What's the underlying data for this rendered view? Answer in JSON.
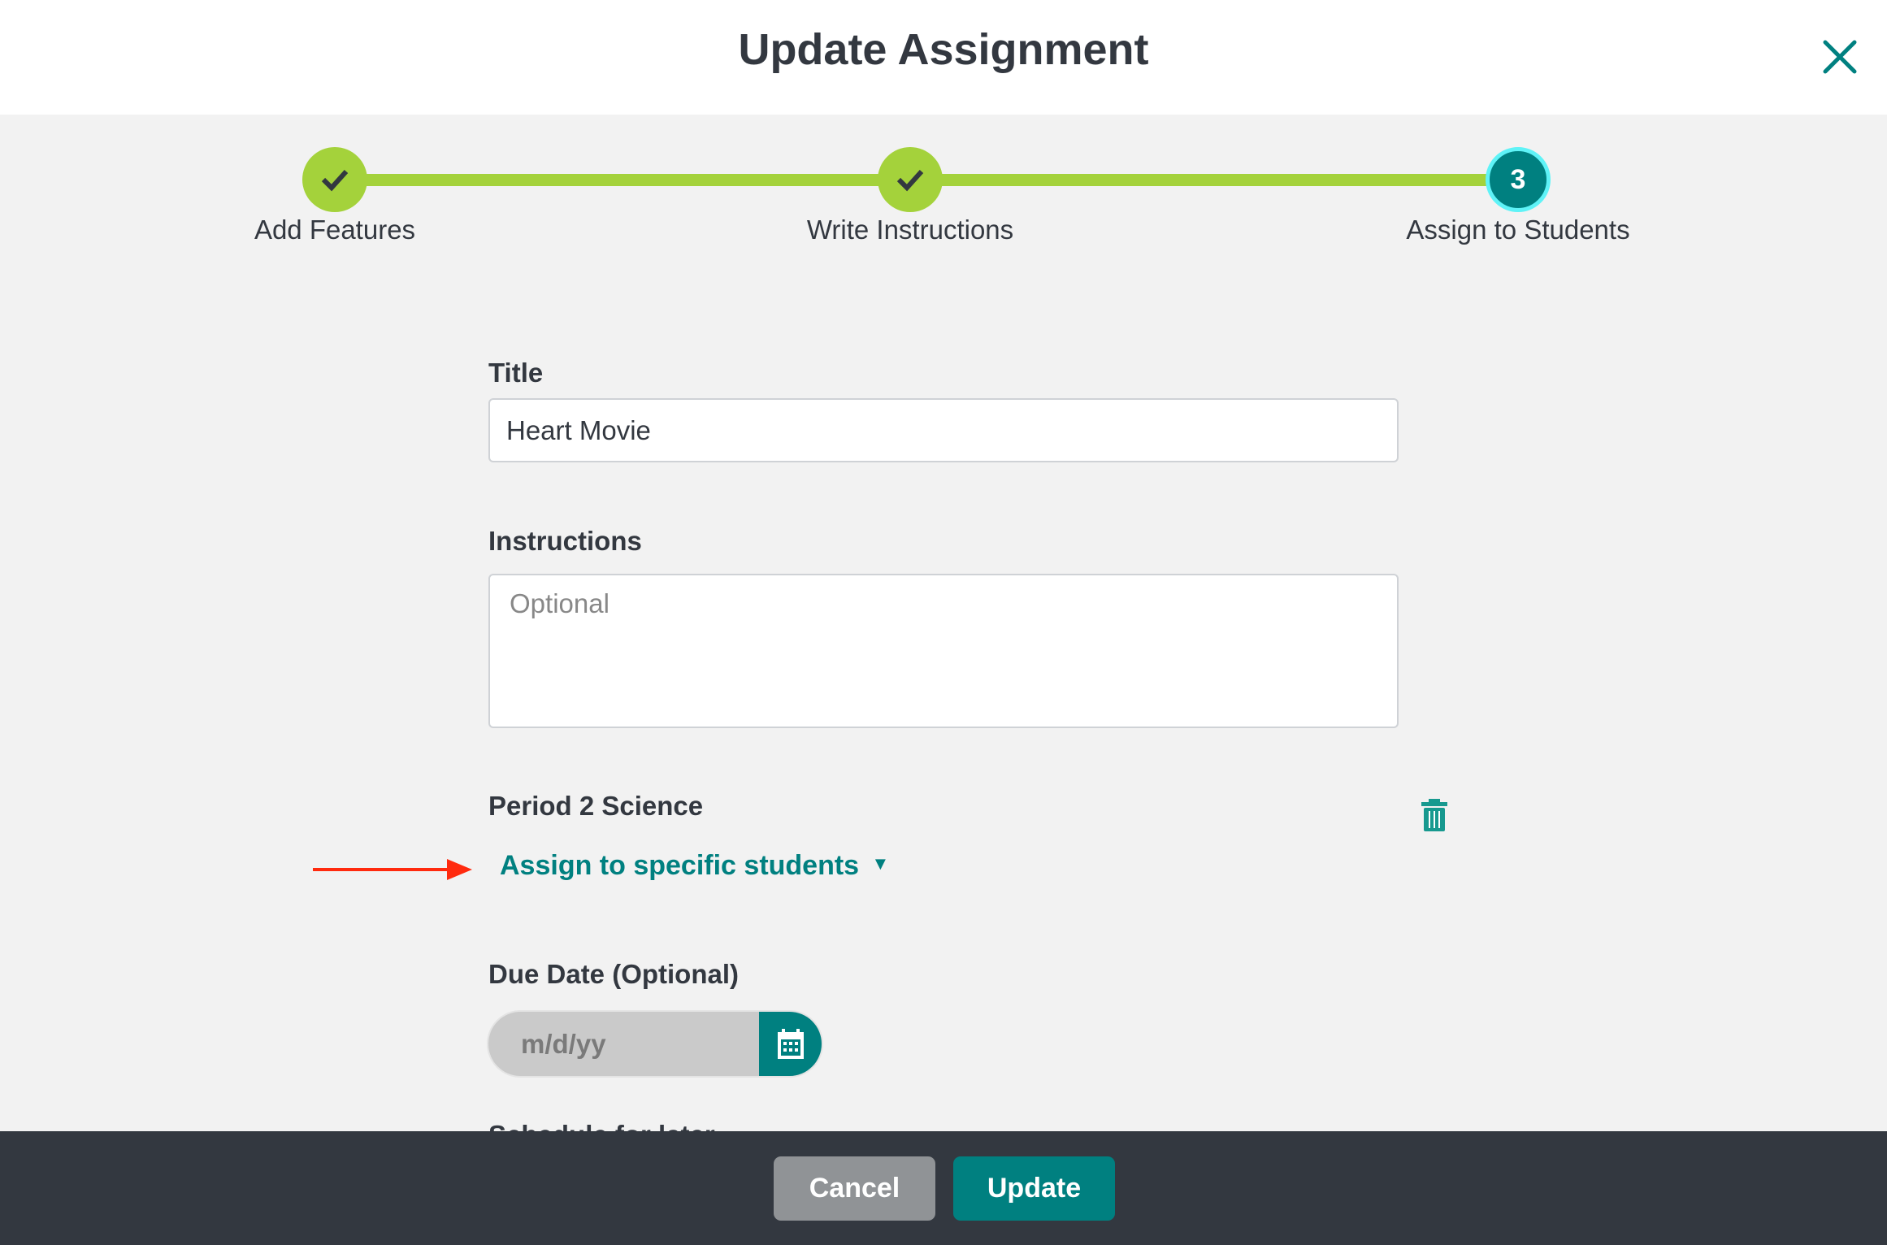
{
  "header": {
    "title": "Update Assignment",
    "close_icon": "close-x-icon"
  },
  "stepper": {
    "steps": [
      {
        "label": "Add Features",
        "state": "complete"
      },
      {
        "label": "Write Instructions",
        "state": "complete"
      },
      {
        "label": "Assign to Students",
        "state": "current",
        "number": "3"
      }
    ]
  },
  "form": {
    "title_label": "Title",
    "title_value": "Heart Movie",
    "instructions_label": "Instructions",
    "instructions_placeholder": "Optional",
    "class_name": "Period 2 Science",
    "assign_link": "Assign to specific students",
    "due_date_label": "Due Date (Optional)",
    "due_date_placeholder": "m/d/yy",
    "schedule_label": "Schedule for later"
  },
  "footer": {
    "cancel_label": "Cancel",
    "update_label": "Update"
  },
  "colors": {
    "accent": "#008080",
    "progress": "#a4d23b",
    "annotation_arrow": "#ff2a0e",
    "footer": "#333840"
  }
}
